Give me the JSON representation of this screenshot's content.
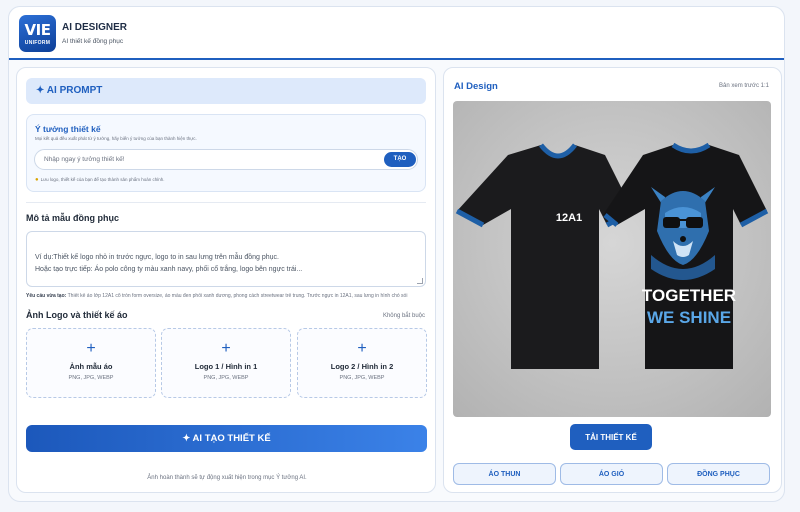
{
  "header": {
    "logo_line1": "VIE",
    "logo_line2": "UNIFORM",
    "title": "AI DESIGNER",
    "subtitle": "AI thiết kế đồng phục"
  },
  "prompt": {
    "banner_label": "✦ AI PROMPT",
    "idea_title": "Ý tưởng thiết kế",
    "idea_desc": "Mọi kết quả đều xuất phát từ ý tưởng, hãy biến ý tưởng của bạn thành hiện thực.",
    "idea_placeholder": "Nhập ngay ý tưởng thiết kế!",
    "create_short": "TẠO",
    "idea_note": "Lưu logo, thiết kế của bạn để tạo thành sản phẩm hoàn chỉnh."
  },
  "description": {
    "label": "Mô tả mẫu đồng phục",
    "placeholder": "Ví dụ:Thiết kế logo nhỏ in trước ngực, logo to in sau lưng trên mẫu đồng phục.\nHoặc tạo trực tiếp: Áo polo công ty màu xanh navy, phối cổ trắng, logo bên ngực trái...",
    "req_label": "Yêu cầu vừa tạo:",
    "req_text": "Thiết kế áo lớp 12A1 cổ tròn form oversize, áo màu đen phối xanh dương, phong cách streetwear trẻ trung. Trước ngực in 12A1, sau lưng in hình chó sói"
  },
  "uploads": {
    "label": "Ảnh Logo và thiết kế áo",
    "optional": "Không bắt buộc",
    "items": [
      {
        "title": "Ảnh mẫu áo",
        "types": "PNG, JPG, WEBP"
      },
      {
        "title": "Logo 1 / Hình in 1",
        "types": "PNG, JPG, WEBP"
      },
      {
        "title": "Logo 2 / Hình in 2",
        "types": "PNG, JPG, WEBP"
      }
    ]
  },
  "actions": {
    "create_label": "✦ AI TẠO THIẾT KẾ",
    "footer_note": "Ảnh hoàn thành sẽ tự động xuất hiện trong mục Ý tưởng AI."
  },
  "result": {
    "title": "AI Design",
    "preview_label": "Bản xem trước 1:1",
    "front_print": "12A1",
    "back_line1": "TOGETHER",
    "back_line2": "WE SHINE",
    "download_label": "TẢI THIẾT KẾ",
    "categories": [
      "ÁO THUN",
      "ÁO GIÓ",
      "ĐỒNG PHỤC"
    ]
  },
  "colors": {
    "accent": "#1f5fbf",
    "shirt": "#1b1b1d",
    "trim": "#1e5fa6"
  }
}
